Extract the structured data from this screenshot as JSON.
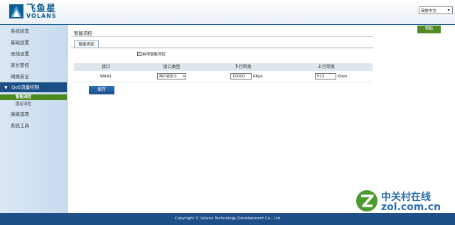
{
  "header": {
    "logo_cn": "飞鱼星",
    "logo_en": "VOLANS",
    "language": "简体中文"
  },
  "help_label": "帮助",
  "sidebar": {
    "items": [
      {
        "label": "系统状态"
      },
      {
        "label": "基础设置"
      },
      {
        "label": "无线设置"
      },
      {
        "label": "家长管控"
      },
      {
        "label": "网络安全"
      }
    ],
    "active_group": "QoS流量控制",
    "sub_items": [
      {
        "label": "智能流控",
        "active": true
      },
      {
        "label": "固定流控",
        "active": false
      }
    ],
    "items_after": [
      {
        "label": "高级选项"
      },
      {
        "label": "系统工具"
      }
    ]
  },
  "main": {
    "page_title": "智能流控",
    "tab_label": "智能流控",
    "enable_label": "启用智能流控",
    "enable_checked": true,
    "table": {
      "headers": [
        "接口",
        "接口类型",
        "下行带宽",
        "上行带宽"
      ],
      "rows": [
        {
          "interface": "WAN1",
          "type": "用户自定义",
          "down": "10000",
          "down_unit": "Kbps",
          "up": "512",
          "up_unit": "Kbps"
        }
      ]
    },
    "save_label": "保存"
  },
  "footer": {
    "copyright": "Copyright © Volans Technology Development Co., Ltd"
  },
  "watermark": {
    "cn": "中关村在线",
    "en": "zol.com.cn"
  },
  "colors": {
    "footer_bg": "#1e4f88",
    "active_nav_bg": "#1b4f86",
    "active_sub_bg": "#4d8a1e",
    "help_bg": "#4f8a24",
    "save_bg": "#2f6fb6"
  }
}
